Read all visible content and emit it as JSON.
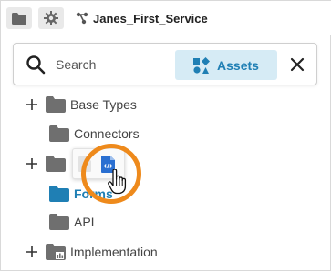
{
  "toolbar": {
    "service_title": "Janes_First_Service",
    "folder_icon": "folder-icon",
    "gear_icon": "gear-icon",
    "service_icon": "service-branch-icon"
  },
  "search": {
    "placeholder": "Search",
    "value": "",
    "assets_label": "Assets",
    "assets_icon": "assets-shapes-icon",
    "close_icon": "close-icon"
  },
  "tree": {
    "items": [
      {
        "label": "Base Types",
        "expander": "+"
      },
      {
        "label": "Connectors",
        "expander": ""
      },
      {
        "label": "",
        "expander": "+"
      },
      {
        "label": "Forms",
        "expander": "",
        "active": true
      },
      {
        "label": "API",
        "expander": ""
      },
      {
        "label": "Implementation",
        "expander": "+"
      }
    ]
  },
  "popover": {
    "icons": [
      "gray-doc-icon",
      "code-doc-icon"
    ],
    "cursor": "hand-pointer-icon"
  },
  "colors": {
    "accent": "#1f7fb4",
    "assets_bg": "#d6ebf5",
    "highlight": "#ee8a1c",
    "folder": "#6f6f6f"
  }
}
